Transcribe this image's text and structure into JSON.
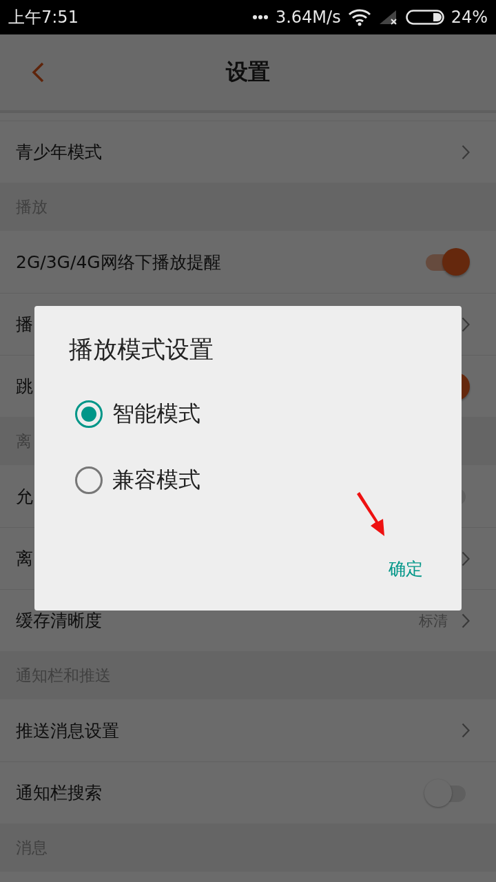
{
  "status_bar": {
    "time": "上午7:51",
    "network_speed": "3.64M/s",
    "battery": "24%"
  },
  "header": {
    "title": "设置"
  },
  "list": [
    {
      "kind": "chevron",
      "label": "青少年模式"
    },
    {
      "kind": "section",
      "label": "播放"
    },
    {
      "kind": "toggle",
      "label": "2G/3G/4G网络下播放提醒",
      "on": true
    },
    {
      "kind": "chevron",
      "label": "播"
    },
    {
      "kind": "toggle",
      "label": "跳",
      "on": true
    },
    {
      "kind": "section",
      "label": "离"
    },
    {
      "kind": "toggle",
      "label": "允",
      "on": false
    },
    {
      "kind": "chevron",
      "label": "离"
    },
    {
      "kind": "value",
      "label": "缓存清晰度",
      "value": "标清"
    },
    {
      "kind": "section",
      "label": "通知栏和推送"
    },
    {
      "kind": "chevron",
      "label": "推送消息设置"
    },
    {
      "kind": "toggle",
      "label": "通知栏搜索",
      "on": false
    },
    {
      "kind": "section",
      "label": "消息"
    }
  ],
  "dialog": {
    "title": "播放模式设置",
    "options": [
      {
        "label": "智能模式",
        "selected": true
      },
      {
        "label": "兼容模式",
        "selected": false
      }
    ],
    "confirm": "确定"
  }
}
